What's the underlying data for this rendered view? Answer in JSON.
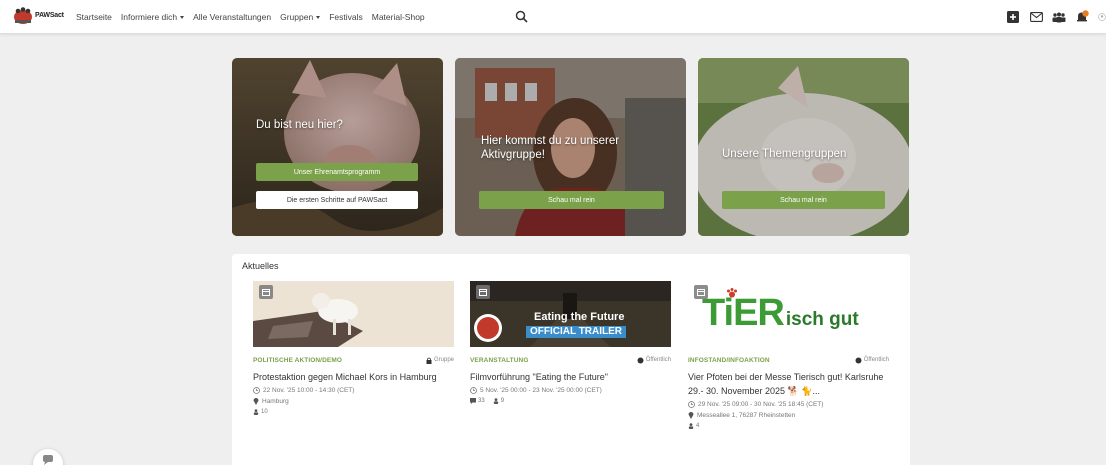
{
  "nav": {
    "brand": "PAWSact",
    "links": [
      {
        "label": "Startseite"
      },
      {
        "label": "Informiere dich",
        "dropdown": true
      },
      {
        "label": "Alle Veranstaltungen"
      },
      {
        "label": "Gruppen",
        "dropdown": true
      },
      {
        "label": "Festivals"
      },
      {
        "label": "Material-Shop"
      }
    ],
    "right_icons": [
      "plus-square-icon",
      "mail-icon",
      "groups-icon",
      "notification-icon",
      "avatar"
    ],
    "notification_badge": "",
    "accent": "#7ba14a"
  },
  "hero": [
    {
      "title": "Du bist neu hier?",
      "buttons": [
        {
          "label": "Unser Ehrenamtsprogramm",
          "style": "green"
        },
        {
          "label": "Die ersten Schritte auf PAWSact",
          "style": "white"
        }
      ]
    },
    {
      "title": "Hier kommst du zu unserer Aktivgruppe!",
      "buttons": [
        {
          "label": "Schau mal rein",
          "style": "green"
        }
      ]
    },
    {
      "title": "Unsere Themengruppen",
      "buttons": [
        {
          "label": "Schau mal rein",
          "style": "green"
        }
      ]
    }
  ],
  "news": {
    "title": "Aktuelles",
    "items": [
      {
        "category": "POLITISCHE AKTION/DEMO",
        "visibility": "Gruppe",
        "title": "Protestaktion gegen Michael Kors in Hamburg",
        "date": "22 Nov. '25 10:00 - 14:30 (CET)",
        "location": "Hamburg",
        "participants": "10"
      },
      {
        "category": "VERANSTALTUNG",
        "visibility": "Öffentlich",
        "title": "Filmvorführung \"Eating the Future\"",
        "image_text_1": "Eating the Future",
        "image_text_2": "OFFICIAL TRAILER",
        "date": "5 Nov. '25 00:00 - 23 Nov. '25 00:00 (CET)",
        "comments": "33",
        "participants": "9"
      },
      {
        "category": "INFOSTAND/INFOAKTION",
        "visibility": "Öffentlich",
        "title": "Vier Pfoten bei der Messe Tierisch gut! Karlsruhe 29.- 30. November 2025 🐕 🐈...",
        "image_text_main": "TiER",
        "image_text_suffix": "isch gut",
        "date": "29 Nov. '25 09:00 - 30 Nov. '25 18:45 (CET)",
        "location": "Messeallee 1, 76287 Rheinstetten",
        "participants": "4"
      }
    ]
  }
}
